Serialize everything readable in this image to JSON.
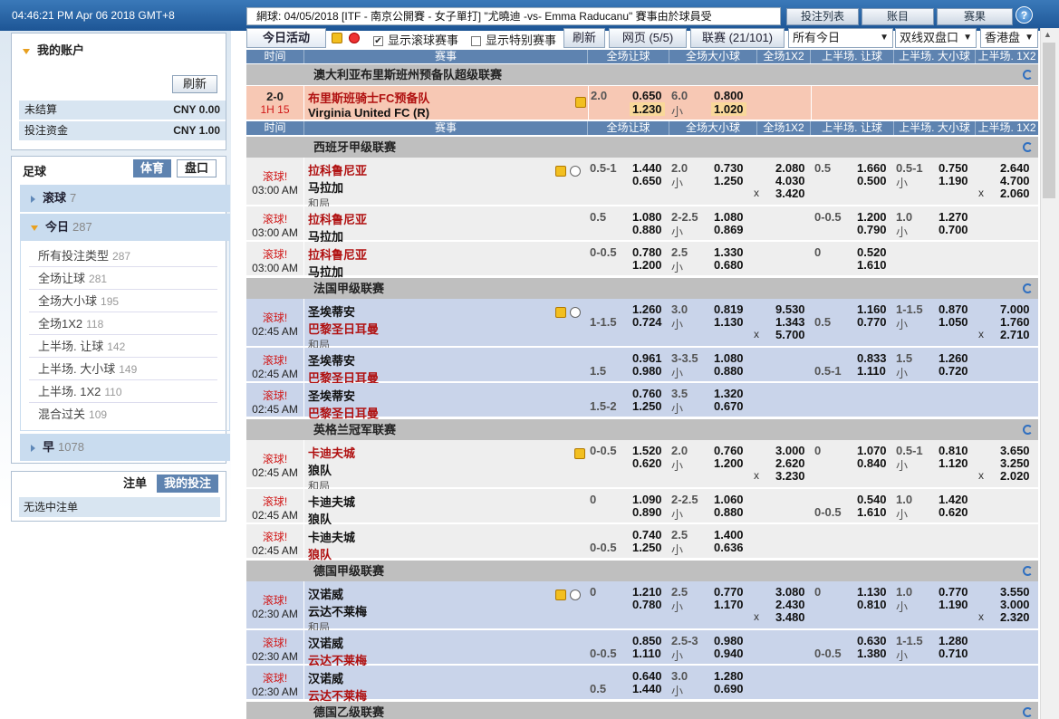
{
  "header": {
    "clock": "04:46:21 PM Apr 06 2018 GMT+8",
    "ticker": "網球: 04/05/2018 [ITF - 南京公開賽 - 女子單打] \"尤曉迪 -vs- Emma Raducanu\" 賽事由於球員受",
    "buttons": [
      "投注列表",
      "账目",
      "赛果"
    ],
    "help": "?"
  },
  "account": {
    "title": "我的账户",
    "refresh": "刷新",
    "rows": [
      {
        "label": "未结算",
        "value": "CNY 0.00"
      },
      {
        "label": "投注资金",
        "value": "CNY 1.00"
      }
    ]
  },
  "sports": {
    "title": "足球",
    "tab1": "体育",
    "tab2": "盘口",
    "live": {
      "label": "滚球",
      "count": "7"
    },
    "today": {
      "label": "今日",
      "count": "287"
    },
    "items": [
      {
        "label": "所有投注类型",
        "count": "287"
      },
      {
        "label": "全场让球",
        "count": "281"
      },
      {
        "label": "全场大小球",
        "count": "195"
      },
      {
        "label": "全场1X2",
        "count": "118"
      },
      {
        "label": "上半场. 让球",
        "count": "142"
      },
      {
        "label": "上半场. 大小球",
        "count": "149"
      },
      {
        "label": "上半场. 1X2",
        "count": "110"
      },
      {
        "label": "混合过关",
        "count": "109"
      }
    ],
    "early": {
      "label": "早",
      "count": "1078"
    }
  },
  "betslip": {
    "tab1": "注单",
    "tab2": "我的投注",
    "empty": "无选中注单"
  },
  "toolbar": {
    "tab": "今日活动",
    "show_live": "显示滚球赛事",
    "show_special": "显示特别赛事",
    "refresh": "刷新",
    "page": "网页 (5/5)",
    "league": "联赛 (21/101)",
    "filter": "所有今日",
    "odds_type": "双线双盘口",
    "region": "香港盘"
  },
  "headers": [
    "时间",
    "赛事",
    "全场让球",
    "全场大小球",
    "全场1X2",
    "上半场. 让球",
    "上半场. 大小球",
    "上半场. 1X2"
  ],
  "leagues": [
    "澳大利亚布里斯班州预备队超级联赛",
    "西班牙甲级联赛",
    "法国甲级联赛",
    "英格兰冠军联赛",
    "德国甲级联赛",
    "德国乙级联赛"
  ],
  "live_match": {
    "score": "2-0",
    "period": "1H 15",
    "home": "布里斯班骑士FC预备队",
    "away": "Virginia United FC (R)",
    "hdp": "2.0",
    "hdp_h": "0.650",
    "hdp_a": "1.230",
    "ou": "6.0",
    "ou_u": "小",
    "ou_o": "0.800",
    "ou_uo": "1.020"
  },
  "live_label": "滚球!",
  "draw_label": "和局",
  "small": "小",
  "x": "x",
  "spain": {
    "home": "拉科鲁尼亚",
    "away": "马拉加",
    "time": "03:00 AM",
    "r1": {
      "hdp": "0.5-1",
      "hh": "1.440",
      "ha": "0.650",
      "ou": "2.0",
      "oo": "0.730",
      "ou2": "1.250",
      "x1": "2.080",
      "x2": "4.030",
      "xd": "3.420",
      "fh": "0.5",
      "fhh": "1.660",
      "fha": "0.500",
      "fou": "0.5-1",
      "fo": "0.750",
      "fu": "1.190",
      "f1": "2.640",
      "f2": "4.700",
      "fd": "2.060"
    },
    "r2": {
      "hdp": "0.5",
      "hh": "1.080",
      "ha": "0.880",
      "ou": "2-2.5",
      "oo": "1.080",
      "ou2": "0.869",
      "fh": "0-0.5",
      "fhh": "1.200",
      "fha": "0.790",
      "fou": "1.0",
      "fo": "1.270",
      "fu": "0.700"
    },
    "r3": {
      "hdp": "0-0.5",
      "hh": "0.780",
      "ha": "1.200",
      "ou": "2.5",
      "oo": "1.330",
      "ou2": "0.680",
      "fh": "0",
      "fhh": "0.520",
      "fha": "1.610"
    }
  },
  "france": {
    "home": "圣埃蒂安",
    "away": "巴黎圣日耳曼",
    "time": "02:45 AM",
    "r1": {
      "hdp": "1-1.5",
      "hh": "1.260",
      "ha": "0.724",
      "ou": "3.0",
      "oo": "0.819",
      "ou2": "1.130",
      "x1": "9.530",
      "x2": "1.343",
      "xd": "5.700",
      "fh": "0.5",
      "fhh": "1.160",
      "fha": "0.770",
      "fou": "1-1.5",
      "fo": "0.870",
      "fu": "1.050",
      "f1": "7.000",
      "f2": "1.760",
      "fd": "2.710"
    },
    "r2": {
      "hdp": "1.5",
      "hh": "0.961",
      "ha": "0.980",
      "ou": "3-3.5",
      "oo": "1.080",
      "ou2": "0.880",
      "fh": "0.5-1",
      "fhh": "0.833",
      "fha": "1.110",
      "fou": "1.5",
      "fo": "1.260",
      "fu": "0.720"
    },
    "r3": {
      "hdp": "1.5-2",
      "hh": "0.760",
      "ha": "1.250",
      "ou": "3.5",
      "oo": "1.320",
      "ou2": "0.670"
    }
  },
  "england": {
    "home": "卡迪夫城",
    "away": "狼队",
    "time": "02:45 AM",
    "r1": {
      "hdp": "0-0.5",
      "hh": "1.520",
      "ha": "0.620",
      "ou": "2.0",
      "oo": "0.760",
      "ou2": "1.200",
      "x1": "3.000",
      "x2": "2.620",
      "xd": "3.230",
      "fh": "0",
      "fhh": "1.070",
      "fha": "0.840",
      "fou": "0.5-1",
      "fo": "0.810",
      "fu": "1.120",
      "f1": "3.650",
      "f2": "3.250",
      "fd": "2.020"
    },
    "r2": {
      "hdp": "0",
      "hh": "1.090",
      "ha": "0.890",
      "ou": "2-2.5",
      "oo": "1.060",
      "ou2": "0.880",
      "fh": "0-0.5",
      "fhh": "0.540",
      "fha": "1.610",
      "fou": "1.0",
      "fo": "1.420",
      "fu": "0.620"
    },
    "r3": {
      "hdp": "0-0.5",
      "hh": "0.740",
      "ha": "1.250",
      "ou": "2.5",
      "oo": "1.400",
      "ou2": "0.636"
    }
  },
  "germany": {
    "home": "汉诺威",
    "away": "云达不莱梅",
    "time": "02:30 AM",
    "r1": {
      "hdp": "0",
      "hh": "1.210",
      "ha": "0.780",
      "ou": "2.5",
      "oo": "0.770",
      "ou2": "1.170",
      "x1": "3.080",
      "x2": "2.430",
      "xd": "3.480",
      "fh": "0",
      "fhh": "1.130",
      "fha": "0.810",
      "fou": "1.0",
      "fo": "0.770",
      "fu": "1.190",
      "f1": "3.550",
      "f2": "3.000",
      "fd": "2.320"
    },
    "r2": {
      "hdp": "0-0.5",
      "hh": "0.850",
      "ha": "1.110",
      "ou": "2.5-3",
      "oo": "0.980",
      "ou2": "0.940",
      "fh": "0-0.5",
      "fhh": "0.630",
      "fha": "1.380",
      "fou": "1-1.5",
      "fo": "1.280",
      "fu": "0.710"
    },
    "r3": {
      "hdp": "0.5",
      "hh": "0.640",
      "ha": "1.440",
      "ou": "3.0",
      "oo": "1.280",
      "ou2": "0.690"
    }
  }
}
